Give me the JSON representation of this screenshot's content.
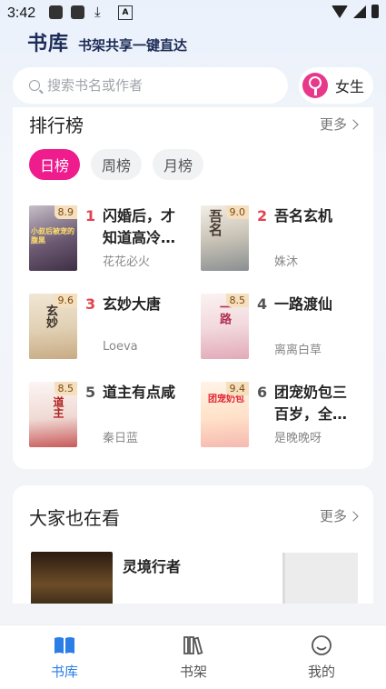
{
  "status_bar": {
    "time": "3:42"
  },
  "brand": {
    "title": "书库",
    "slogan": "书架共享一键直达"
  },
  "search": {
    "placeholder": "搜索书名或作者"
  },
  "gender_switch": {
    "label": "女生"
  },
  "ranking": {
    "title": "排行榜",
    "more": "更多",
    "tabs": [
      "日榜",
      "周榜",
      "月榜"
    ],
    "active_tab": "日榜",
    "books": [
      {
        "rank": "1",
        "title": "闪婚后，才知道高冷总裁是",
        "author": "花花必火",
        "score": "8.9"
      },
      {
        "rank": "2",
        "title": "吾名玄机",
        "author": "姝沐",
        "score": "9.0"
      },
      {
        "rank": "3",
        "title": "玄妙大唐",
        "author": "Loeva",
        "score": "9.6"
      },
      {
        "rank": "4",
        "title": "一路渡仙",
        "author": "离离白草",
        "score": "8.5"
      },
      {
        "rank": "5",
        "title": "道主有点咸",
        "author": "秦日蓝",
        "score": "8.5"
      },
      {
        "rank": "6",
        "title": "团宠奶包三百岁，全家都是",
        "author": "是晚晚呀",
        "score": "9.4"
      }
    ]
  },
  "also_watching": {
    "title": "大家也在看",
    "more": "更多",
    "first_book_title": "灵境行者"
  },
  "bottom_nav": [
    {
      "label": "书库",
      "icon": "book-open-icon",
      "active": true
    },
    {
      "label": "书架",
      "icon": "bookshelf-icon",
      "active": false
    },
    {
      "label": "我的",
      "icon": "smiley-face-icon",
      "active": false
    }
  ],
  "colors": {
    "accent": "#ee1c8d",
    "rank_top": "#e14450",
    "nav_active": "#2a7ee6",
    "brand_text": "#1d2c57"
  }
}
